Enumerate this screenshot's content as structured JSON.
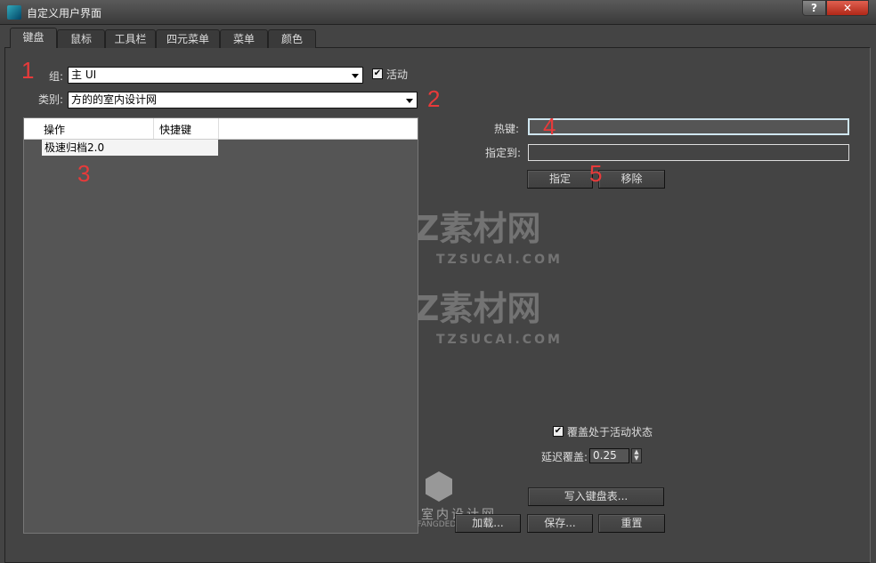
{
  "window": {
    "title": "自定义用户界面",
    "help": "?",
    "close": "✕"
  },
  "tabs": [
    "键盘",
    "鼠标",
    "工具栏",
    "四元菜单",
    "菜单",
    "颜色"
  ],
  "group": {
    "label": "组:",
    "value": "主 UI",
    "active_label": "活动",
    "active_checked": true
  },
  "category": {
    "label": "类别:",
    "value": "方的的室内设计网"
  },
  "list": {
    "columns": [
      "操作",
      "快捷键"
    ],
    "rows": [
      {
        "action": "极速归档2.0",
        "shortcut": ""
      }
    ]
  },
  "hotkey": {
    "label": "热键:",
    "value": ""
  },
  "assigned": {
    "label": "指定到:",
    "value": ""
  },
  "buttons": {
    "assign": "指定",
    "remove": "移除",
    "write": "写入键盘表...",
    "load": "加载...",
    "save": "保存...",
    "reset": "重置"
  },
  "override": {
    "label": "覆盖处于活动状态",
    "checked": true,
    "delay_label": "延迟覆盖:",
    "delay_value": "0.25"
  },
  "annotations": [
    "1",
    "2",
    "3",
    "4",
    "5"
  ],
  "watermarks": {
    "tz": "TZ素材网",
    "tz_url": "TZSUCAI.COM",
    "fd": "方的的室内设计网",
    "fd_url": "WWW.FANGDEDE.COM"
  }
}
